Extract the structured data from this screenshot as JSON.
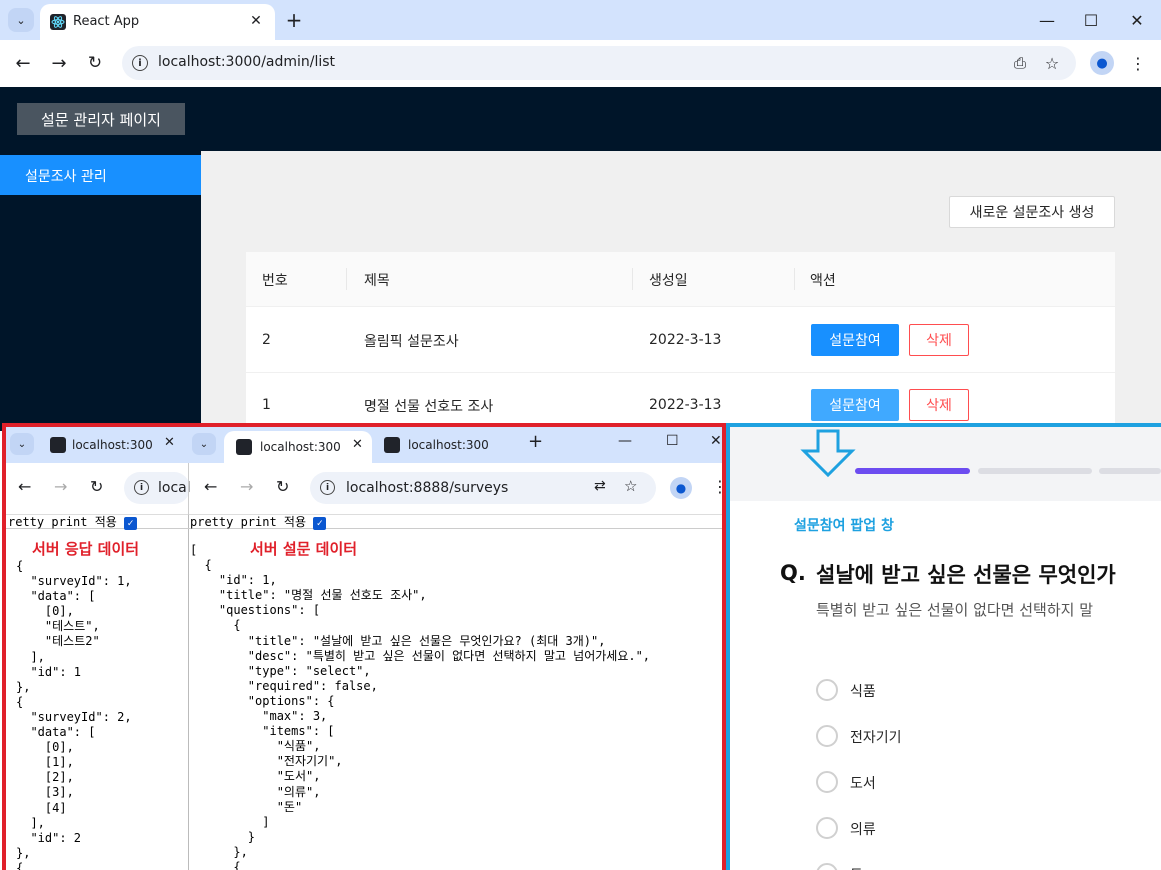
{
  "browser": {
    "tab_title": "React App",
    "url": "localhost:3000/admin/list"
  },
  "app": {
    "header_title": "설문 관리자 페이지",
    "sidebar_item": "설문조사 관리",
    "create_button": "새로운 설문조사 생성",
    "table": {
      "headers": [
        "번호",
        "제목",
        "생성일",
        "액션"
      ],
      "rows": [
        {
          "no": "2",
          "title": "올림픽 설문조사",
          "date": "2022-3-13"
        },
        {
          "no": "1",
          "title": "명절 선물 선호도 조사",
          "date": "2022-3-13"
        }
      ],
      "join_label": "설문참여",
      "delete_label": "삭제"
    }
  },
  "win_left": {
    "tab1": "localhost:300",
    "tab2": "localhost:300",
    "tab3": "localhost:300",
    "url_left": "local",
    "url_right": "localhost:8888/surveys",
    "pretty_left": "retty print 적용",
    "pretty_right": "pretty print 적용",
    "label_response": "서버 응답 데이터",
    "label_survey": "서버 설문 데이터",
    "json_left": "{\n  \"surveyId\": 1,\n  \"data\": [\n    [0],\n    \"테스트\",\n    \"테스트2\"\n  ],\n  \"id\": 1\n},\n{\n  \"surveyId\": 2,\n  \"data\": [\n    [0],\n    [1],\n    [2],\n    [3],\n    [4]\n  ],\n  \"id\": 2\n},\n{",
    "json_right": "[\n  {\n    \"id\": 1,\n    \"title\": \"명절 선물 선호도 조사\",\n    \"questions\": [\n      {\n        \"title\": \"설날에 받고 싶은 선물은 무엇인가요? (최대 3개)\",\n        \"desc\": \"특별히 받고 싶은 선물이 없다면 선택하지 말고 넘어가세요.\",\n        \"type\": \"select\",\n        \"required\": false,\n        \"options\": {\n          \"max\": 3,\n          \"items\": [\n            \"식품\",\n            \"전자기기\",\n            \"도서\",\n            \"의류\",\n            \"돈\"\n          ]\n        }\n      },\n      {"
  },
  "popup": {
    "label": "설문참여 팝업 창",
    "q_prefix": "Q.",
    "question": "설날에 받고 싶은 선물은 무엇인가",
    "desc": "특별히 받고 싶은 선물이 없다면 선택하지 말",
    "options": [
      "식품",
      "전자기기",
      "도서",
      "의류",
      "돈"
    ]
  },
  "colors": {
    "accent": "#1890ff",
    "header_bg": "#001529",
    "danger": "#ff4d4f",
    "red_frame": "#e0202a",
    "blue_frame": "#1ea1e0",
    "progress": "#6c4cf0"
  }
}
